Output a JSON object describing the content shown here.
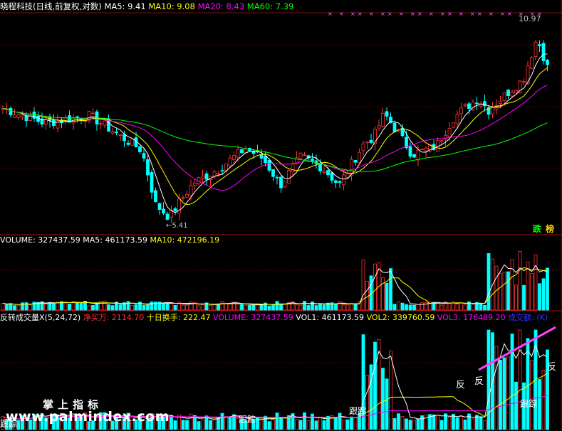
{
  "chart_data": {
    "type": "candlestick",
    "price_panel": {
      "title": "晓程科技(日线,前复权,对数)",
      "indicators": [
        {
          "label": "MA5: 9.41",
          "color": "#ffffff"
        },
        {
          "label": "MA10: 9.08",
          "color": "#ffff00"
        },
        {
          "label": "MA20: 8.43",
          "color": "#ff00ff"
        },
        {
          "label": "MA60: 7.39",
          "color": "#00ff00"
        }
      ],
      "high_label": "10.97",
      "low_label": "5.41",
      "tag_left": "跌",
      "tag_right": "榜",
      "approx_price_range": [
        5.4,
        11.0
      ],
      "series_shown": [
        "candles",
        "MA5",
        "MA10",
        "MA20",
        "MA60"
      ],
      "pattern": "downtrend to 5.41 low, base, spike, rally to 10.97"
    },
    "volume_panel": {
      "indicators": [
        {
          "label": "VOLUME: 327437.59",
          "color": "#ffffff"
        },
        {
          "label": "MA5: 461173.59",
          "color": "#ffffff"
        },
        {
          "label": "MA10: 472196.19",
          "color": "#ffff00"
        }
      ]
    },
    "reversal_panel": {
      "indicators": [
        {
          "label": "反转成交量X(5,24,72)",
          "color": "#ffffff"
        },
        {
          "label": "净买万: 2114.70",
          "color": "#ff3333"
        },
        {
          "label": "十日换手: 222.47",
          "color": "#ffff00"
        },
        {
          "label": "VOLUME: 327437.59",
          "color": "#ff00ff"
        },
        {
          "label": "VOL1: 461173.59",
          "color": "#ffffff"
        },
        {
          "label": "VOL2: 339760.59",
          "color": "#ffff00"
        },
        {
          "label": "VOL3: 176489.20",
          "color": "#ff00ff"
        },
        {
          "label": "成交额:",
          "color": "#3333ff"
        },
        {
          "label": "(K)",
          "color": "#3333ff"
        }
      ],
      "markers": [
        "反",
        "反",
        "反",
        "跟踪",
        "跟踪",
        "跟踪",
        "跟踪"
      ]
    }
  },
  "watermark": {
    "line1": "掌上指标",
    "line2": "www.palmindex.com"
  }
}
